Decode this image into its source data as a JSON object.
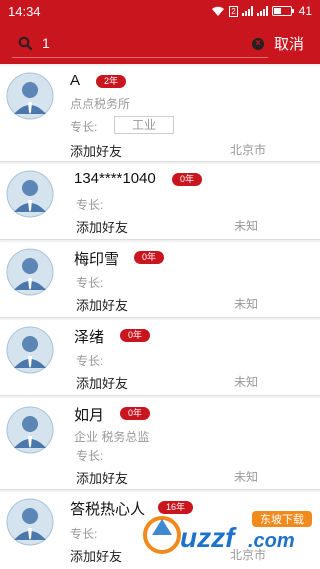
{
  "status_bar": {
    "time": "14:34",
    "network": "2",
    "battery": "41"
  },
  "search": {
    "value": "1",
    "placeholder": "",
    "cancel_label": "取消"
  },
  "items": [
    {
      "name": "A",
      "badge": "2年",
      "company": "点点税务所",
      "spec_label": "专长:",
      "spec_value": "工业",
      "add_label": "添加好友",
      "location": "北京市"
    },
    {
      "name": "134****1040",
      "badge": "0年",
      "company": "",
      "spec_label": "专长:",
      "spec_value": "",
      "add_label": "添加好友",
      "location": "未知"
    },
    {
      "name": "梅印雪",
      "badge": "0年",
      "company": "",
      "spec_label": "专长:",
      "spec_value": "",
      "add_label": "添加好友",
      "location": "未知"
    },
    {
      "name": "泽绪",
      "badge": "0年",
      "company": "",
      "spec_label": "专长:",
      "spec_value": "",
      "add_label": "添加好友",
      "location": "未知"
    },
    {
      "name": "如月",
      "badge": "0年",
      "company": "企业 税务总监",
      "spec_label": "专长:",
      "spec_value": "",
      "add_label": "添加好友",
      "location": "未知"
    },
    {
      "name": "答税热心人",
      "badge": "16年",
      "company": "",
      "spec_label": "专长:",
      "spec_value": "",
      "add_label": "添加好友",
      "location": "北京市"
    }
  ],
  "watermark": {
    "text": "uzzf",
    "suffix": ".com",
    "tag": "东坡下载"
  },
  "colors": {
    "brand": "#c8151e",
    "muted": "#999999"
  }
}
